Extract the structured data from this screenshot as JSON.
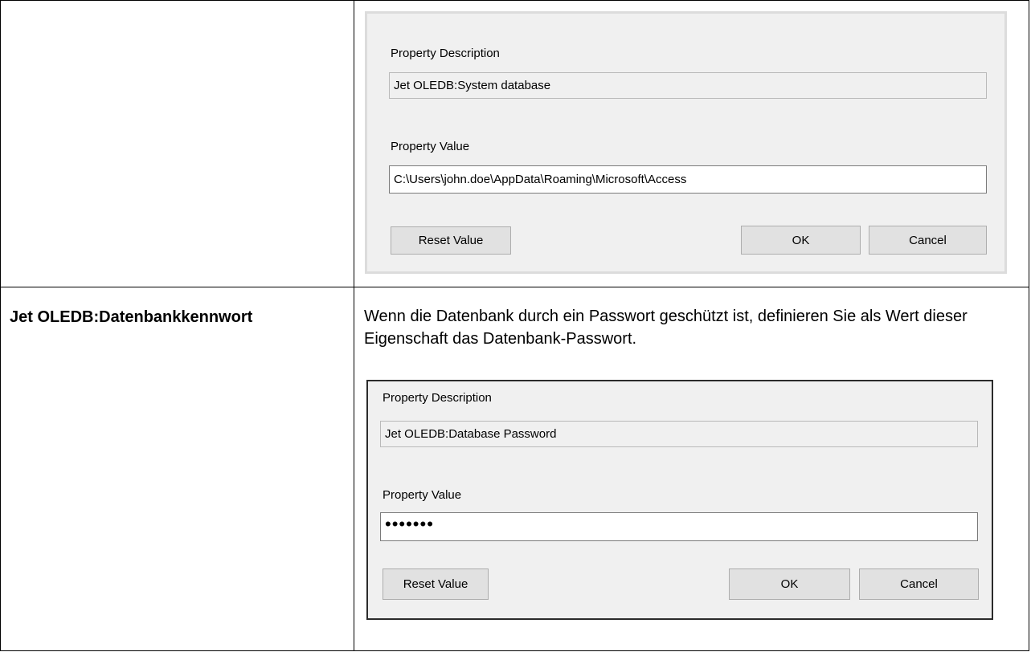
{
  "rows": [
    {
      "term": "",
      "description": "",
      "dialog": {
        "desc_label": "Property Description",
        "desc_value": "Jet OLEDB:System database",
        "value_label": "Property Value",
        "value_value": "C:\\Users\\john.doe\\AppData\\Roaming\\Microsoft\\Access",
        "reset_label": "Reset Value",
        "ok_label": "OK",
        "cancel_label": "Cancel"
      }
    },
    {
      "term": "Jet OLEDB:Datenbankkennwort",
      "description": "Wenn die Datenbank durch ein Passwort geschützt ist, definieren Sie als Wert dieser Eigenschaft das Datenbank-Passwort.",
      "dialog": {
        "desc_label": "Property Description",
        "desc_value": "Jet OLEDB:Database Password",
        "value_label": "Property Value",
        "value_value": "•••••••",
        "reset_label": "Reset Value",
        "ok_label": "OK",
        "cancel_label": "Cancel"
      }
    }
  ]
}
